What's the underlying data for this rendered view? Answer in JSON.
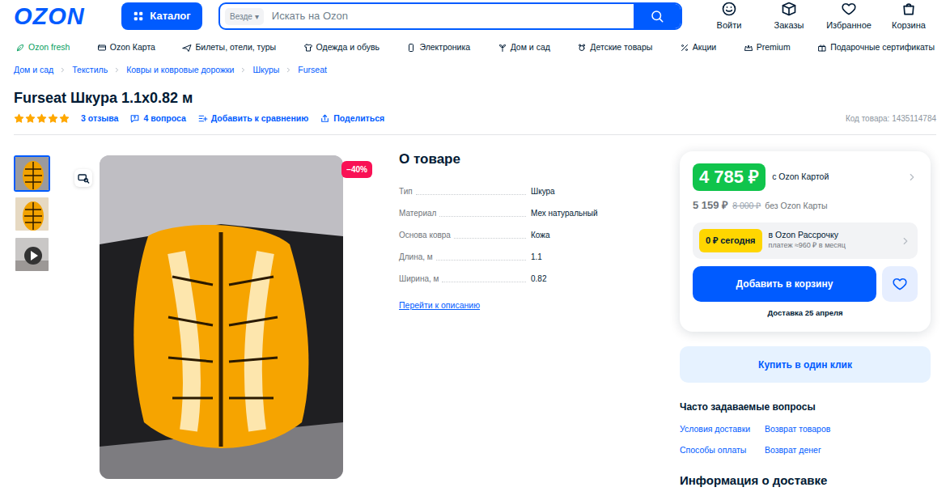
{
  "header": {
    "logo": "OZON",
    "catalog": "Каталог",
    "search": {
      "scope": "Везде",
      "scope_arrow": "▾",
      "placeholder": "Искать на Ozon"
    },
    "actions": [
      {
        "label": "Войти"
      },
      {
        "label": "Заказы"
      },
      {
        "label": "Избранное"
      },
      {
        "label": "Корзина"
      }
    ]
  },
  "nav": {
    "items": [
      {
        "label": "Ozon fresh",
        "color": "#07a05f"
      },
      {
        "label": "Ozon Карта",
        "color": "#001a34"
      },
      {
        "label": "Билеты, отели, туры",
        "color": "#001a34"
      },
      {
        "label": "Одежда и обувь",
        "color": "#001a34"
      },
      {
        "label": "Электроника",
        "color": "#001a34"
      },
      {
        "label": "Дом и сад",
        "color": "#001a34"
      },
      {
        "label": "Детские товары",
        "color": "#001a34"
      },
      {
        "label": "Акции",
        "color": "#001a34"
      },
      {
        "label": "Premium",
        "color": "#001a34"
      },
      {
        "label": "Подарочные сертификаты",
        "color": "#001a34"
      }
    ]
  },
  "breadcrumbs": [
    "Дом и сад",
    "Текстиль",
    "Ковры и ковровые дорожки",
    "Шкуры",
    "Furseat"
  ],
  "product": {
    "title": "Furseat Шкура 1.1x0.82 м",
    "stars": 5,
    "reviews": "3 отзыва",
    "questions": "4 вопроса",
    "compare": "Добавить к сравнению",
    "share": "Поделиться",
    "code": "Код товара: 1435114784"
  },
  "gallery": {
    "thumbs": [
      {
        "kind": "photo",
        "selected": true
      },
      {
        "kind": "photo",
        "selected": false
      },
      {
        "kind": "video",
        "selected": false
      }
    ],
    "discount": "−40%"
  },
  "about": {
    "title": "О товаре",
    "specs": [
      {
        "label": "Тип",
        "value": "Шкура"
      },
      {
        "label": "Материал",
        "value": "Мех натуральный"
      },
      {
        "label": "Основа ковра",
        "value": "Кожа"
      },
      {
        "label": "Длина, м",
        "value": "1.1"
      },
      {
        "label": "Ширина, м",
        "value": "0.82"
      }
    ],
    "link": "Перейти к описанию"
  },
  "buy": {
    "price": "4 785 ₽",
    "price_label": "с Ozon Картой",
    "price2": "5 159 ₽",
    "old_price": "8 000 ₽",
    "price2_label": "без Ozon Карты",
    "installment": {
      "badge": "0 ₽ сегодня",
      "title": "в Ozon Рассрочку",
      "sub": "платеж ≈960 ₽ в месяц"
    },
    "add": "Добавить в корзину",
    "delivery": "Доставка 25 апреля",
    "one_click": "Купить в один клик"
  },
  "faq": {
    "title": "Часто задаваемые вопросы",
    "links": [
      "Условия доставки",
      "Возврат товаров",
      "Способы оплаты",
      "Возврат денег"
    ]
  },
  "delivery_info": {
    "title": "Информация о доставке"
  }
}
